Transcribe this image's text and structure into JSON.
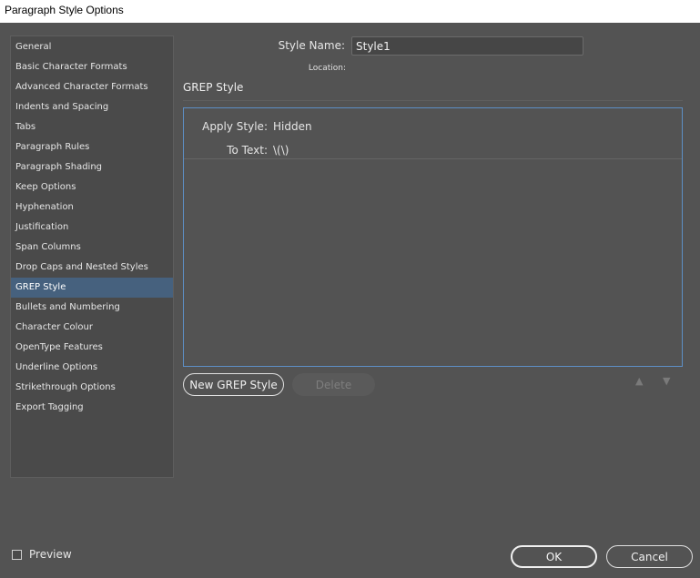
{
  "window": {
    "title": "Paragraph Style Options"
  },
  "sidebar": {
    "items": [
      {
        "label": "General"
      },
      {
        "label": "Basic Character Formats"
      },
      {
        "label": "Advanced Character Formats"
      },
      {
        "label": "Indents and Spacing"
      },
      {
        "label": "Tabs"
      },
      {
        "label": "Paragraph Rules"
      },
      {
        "label": "Paragraph Shading"
      },
      {
        "label": "Keep Options"
      },
      {
        "label": "Hyphenation"
      },
      {
        "label": "Justification"
      },
      {
        "label": "Span Columns"
      },
      {
        "label": "Drop Caps and Nested Styles"
      },
      {
        "label": "GREP Style",
        "selected": true
      },
      {
        "label": "Bullets and Numbering"
      },
      {
        "label": "Character Colour"
      },
      {
        "label": "OpenType Features"
      },
      {
        "label": "Underline Options"
      },
      {
        "label": "Strikethrough Options"
      },
      {
        "label": "Export Tagging"
      }
    ]
  },
  "header": {
    "style_name_label": "Style Name:",
    "style_name_value": "Style1",
    "location_label": "Location:"
  },
  "section": {
    "title": "GREP Style"
  },
  "grep_styles": [
    {
      "apply_style_label": "Apply Style:",
      "apply_style_value": "Hidden",
      "to_text_label": "To Text:",
      "to_text_value": "\\(\\)"
    }
  ],
  "buttons": {
    "new_grep_style": "New GREP Style",
    "delete": "Delete",
    "move_up": "▲",
    "move_down": "▼",
    "ok": "OK",
    "cancel": "Cancel"
  },
  "preview": {
    "label": "Preview",
    "checked": false
  },
  "colors": {
    "background": "#535353",
    "selection": "#46617e",
    "list_border": "#5d8fc6"
  }
}
